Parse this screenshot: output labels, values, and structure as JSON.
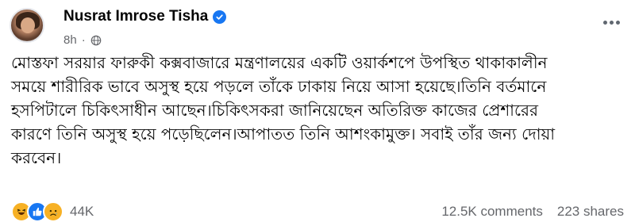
{
  "post": {
    "author": "Nusrat Imrose Tisha",
    "verified": true,
    "time": "8h",
    "privacy_icon": "globe-icon",
    "more_icon": "more-options-icon",
    "lines": [
      "মোস্তফা সরয়ার ফারুকী কক্সবাজারে মন্ত্রণালয়ের একটি ওয়ার্কশপে উপস্থিত থাকাকালীন",
      "সময়ে শারীরিক ভাবে অসুস্থ হয়ে পড়লে তাঁকে ঢাকায় নিয়ে আসা হয়েছে।তিনি বর্তমানে",
      "হসপিটালে চিকিৎসাধীন আছেন।চিকিৎসকরা জানিয়েছেন অতিরিক্ত কাজের প্রেশারের",
      "কারণে তিনি অসুস্থ হয়ে পড়েছিলেন।আপাতত তিনি আশংকামুক্ত। সবাই তাঁর জন্য দোয়া",
      "করবেন।"
    ]
  },
  "reactions": {
    "icons": [
      "haha-icon",
      "like-icon",
      "sad-icon"
    ],
    "count": "44K"
  },
  "stats": {
    "comments": "12.5K comments",
    "shares": "223 shares"
  },
  "colors": {
    "brand_blue": "#1877f2",
    "secondary_text": "#65676b",
    "primary_text": "#050505"
  }
}
